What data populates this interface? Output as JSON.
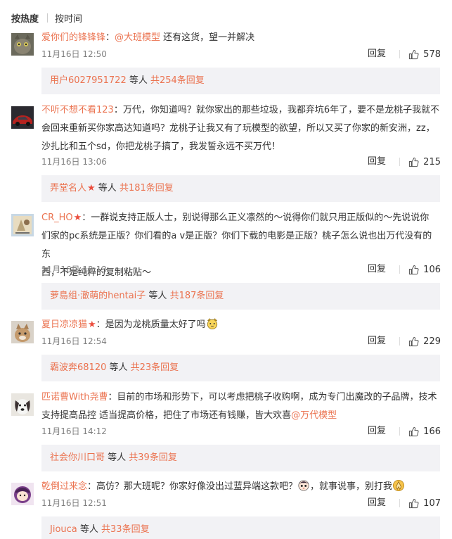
{
  "sort": {
    "hot": "按热度",
    "time": "按时间"
  },
  "comments": [
    {
      "username": "爱你们的锋锋锋",
      "text_before": "：",
      "mention": "@大班模型",
      "text_after": " 还有这货，望一并解决",
      "time": "11月16日 12:50",
      "reply_label": "回复",
      "likes": "578",
      "sub_user": "用户6027951722",
      "sub_mid": " 等人 ",
      "sub_total": "共254条回复"
    },
    {
      "username": "不听不想不看123",
      "lines": [
        "：万代，你知道吗？就你家出的那些垃圾，我都弃坑6年了，要不是龙桃子我就不",
        "会回来重新买你家高达知道吗？龙桃子让我又有了玩模型的欲望，所以又买了你家的新安洲，zz，",
        "沙扎比和五个sd，你把龙桃子搞了，我发誓永远不买万代！"
      ],
      "time": "11月16日 13:06",
      "reply_label": "回复",
      "likes": "215",
      "sub_user": "弄堂名人",
      "sub_mid": " 等人 ",
      "sub_total": "共181条回复"
    },
    {
      "username": "CR_HO",
      "lines": [
        "：一群说支持正版人士，别说得那么正义凛然的～说得你们就只用正版似的～先说说你",
        "们家的pc系统是正版？你们看的a v是正版？你们下载的电影是正版？桃子怎么说也出万代没有的东",
        "西，不是纯粹的复制粘贴～"
      ],
      "time": "11月16日 13:13",
      "reply_label": "回复",
      "likes": "106",
      "sub_user": "萝島组·澈萌的hentai子",
      "sub_mid": " 等人 ",
      "sub_total": "共187条回复"
    },
    {
      "username": "夏日凉凉猫",
      "text": "：是因为龙桃质量太好了吗",
      "time": "11月16日 12:54",
      "reply_label": "回复",
      "likes": "229",
      "sub_user": "霸波奔68120",
      "sub_mid": " 等人 ",
      "sub_total": "共23条回复"
    },
    {
      "username": "匹诺曹With尧曹",
      "lines": [
        "：目前的市场和形势下，可以考虑把桃子收购啊，成为专门出魔改的子品牌，技术",
        "支持提高品控 适当提高价格，把住了市场还有钱赚，皆大欢喜"
      ],
      "mention": "@万代模型",
      "time": "11月16日 14:12",
      "reply_label": "回复",
      "likes": "166",
      "sub_user": "社会你川口哥",
      "sub_mid": " 等人 ",
      "sub_total": "共39条回复"
    },
    {
      "username": "乾倒过来念",
      "text_before": "：高仿？那大班呢？你家好像没出过蓝异端这款吧？",
      "text_after": "，就事说事，别打我",
      "time": "11月16日 12:51",
      "reply_label": "回复",
      "likes": "107",
      "sub_user": "Jiouca",
      "sub_mid": " 等人 ",
      "sub_total": "共33条回复"
    }
  ],
  "colors": {
    "link": "#eb7350",
    "star": "#eb4d3d",
    "reply_bg": "#f2f2f5",
    "meta": "#808080"
  }
}
